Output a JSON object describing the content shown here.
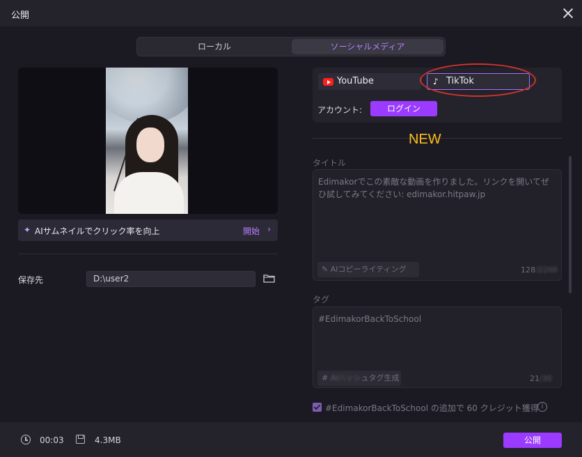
{
  "window": {
    "title": "公開"
  },
  "tabs": [
    {
      "label": "ローカル",
      "selected": false
    },
    {
      "label": "ソーシャルメディア",
      "selected": true
    }
  ],
  "ai_thumbnail": {
    "label": "AIサムネイルでクリック率を向上",
    "action": "開始",
    "icon": "sparkle-icon"
  },
  "save": {
    "label": "保存先",
    "path": "D:\\user2",
    "icon": "folder-icon"
  },
  "platforms": [
    {
      "name": "YouTube",
      "icon": "youtube-icon",
      "selected": false
    },
    {
      "name": "TikTok",
      "icon": "tiktok-icon",
      "selected": true
    }
  ],
  "account": {
    "label": "アカウント:",
    "login_label": "ログイン"
  },
  "annotation": {
    "new_label": "NEW"
  },
  "title_field": {
    "label": "タイトル",
    "value": "Edimakorでこの素敵な動画を作りました。リンクを開いてぜひ試してみてください: edimakor.hitpaw.jp",
    "ai_button": "AIコピーライティング",
    "count": "128"
  },
  "tag_field": {
    "label": "タグ",
    "value": "#EdimakorBackToSchool",
    "tag_button": "ュタグ生成",
    "count": "21"
  },
  "checkbox": {
    "label": "#EdimakorBackToSchool の追加で 60 クレジット獲得",
    "checked": true
  },
  "footer": {
    "duration": "00:03",
    "size": "4.3MB",
    "publish_label": "公開"
  },
  "colors": {
    "accent": "#9a3bff",
    "tab_active_text": "#b780ff",
    "annotation_new": "#ffbe1a",
    "annotation_circle": "#d0332f"
  }
}
